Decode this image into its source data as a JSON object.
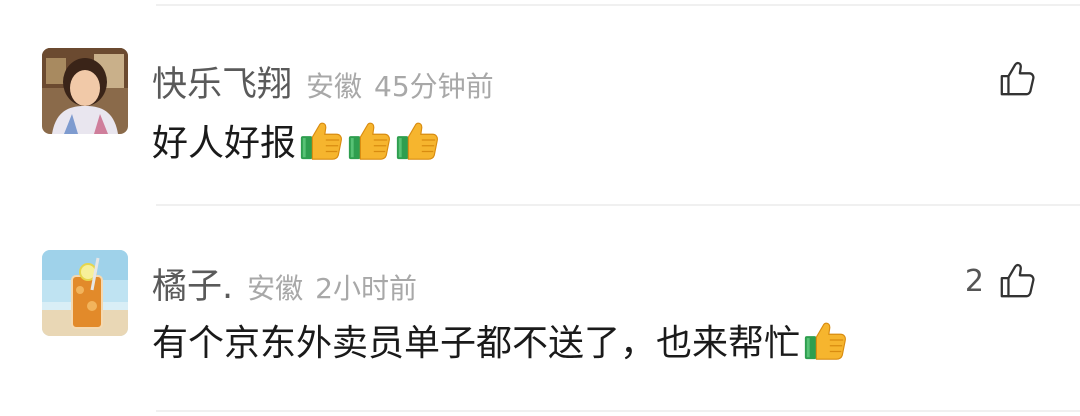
{
  "comments": [
    {
      "username": "快乐飞翔",
      "location": "安徽",
      "time": "45分钟前",
      "text": "好人好报",
      "emoji": [
        "thumbs-up",
        "thumbs-up",
        "thumbs-up"
      ],
      "like_count": "",
      "avatar": "woman-portrait-avatar"
    },
    {
      "username": "橘子.",
      "location": "安徽",
      "time": "2小时前",
      "text": "有个京东外卖员单子都不送了，也来帮忙",
      "emoji": [
        "thumbs-up"
      ],
      "like_count": "2",
      "avatar": "iced-drink-beach-avatar"
    }
  ],
  "colors": {
    "username": "#5a5a5a",
    "meta": "#a8a8a8",
    "text": "#1a1a1a",
    "divider": "#f0f0f0",
    "thumb_yellow": "#f6b52e",
    "sleeve_green": "#2e9e4f"
  }
}
